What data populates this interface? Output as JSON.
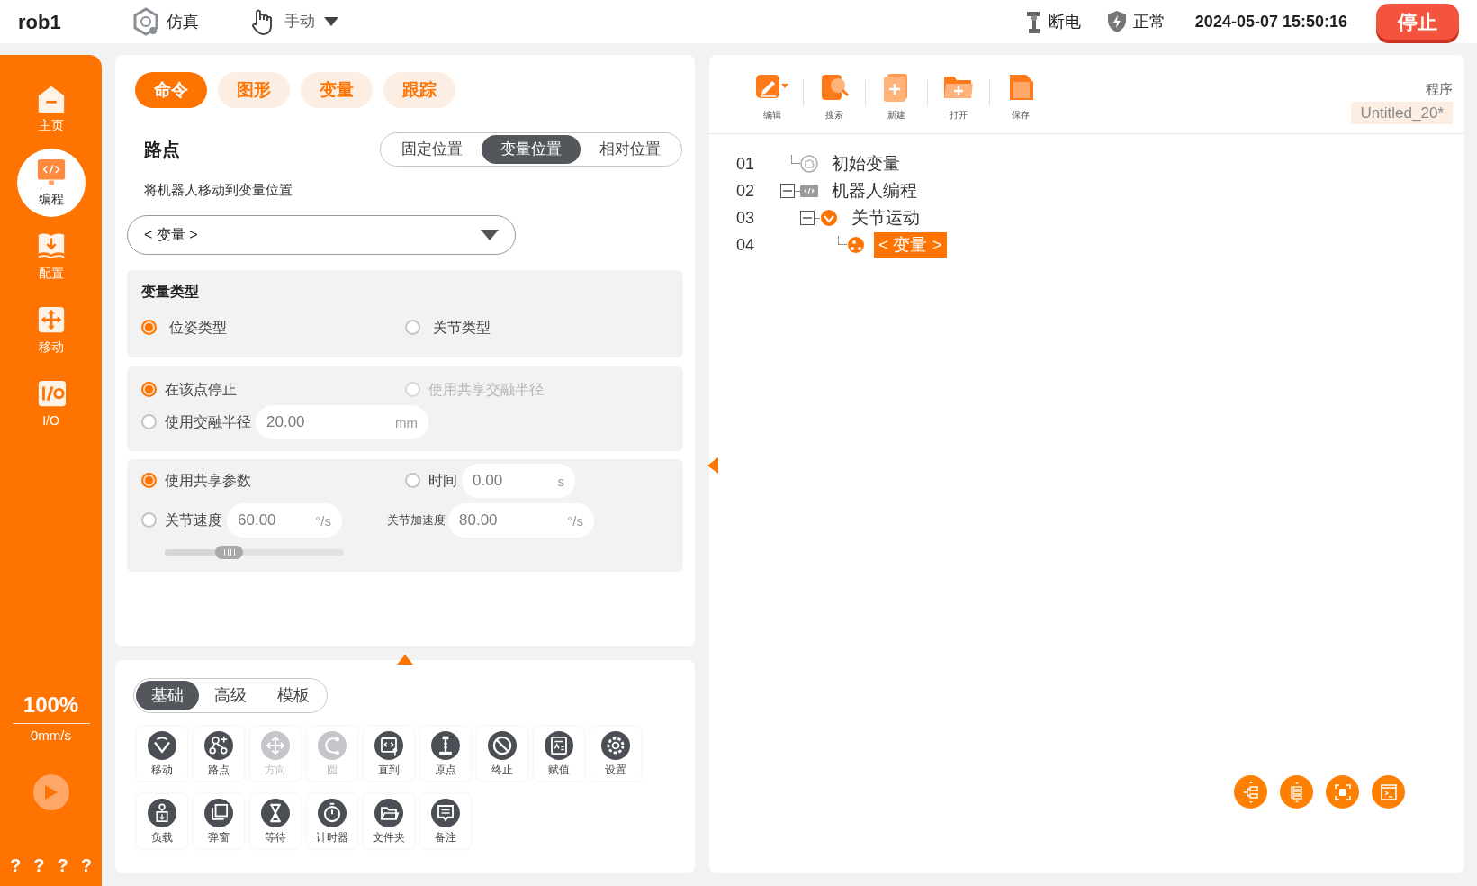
{
  "header": {
    "robot": "rob1",
    "mode": "仿真",
    "control": "手动",
    "power": "断电",
    "safety": "正常",
    "datetime": "2024-05-07 15:50:16",
    "stop": "停止"
  },
  "sidebar": {
    "items": [
      {
        "label": "主页",
        "selected": false
      },
      {
        "label": "编程",
        "selected": true
      },
      {
        "label": "配置",
        "selected": false
      },
      {
        "label": "移动",
        "selected": false
      },
      {
        "label": "I/O",
        "selected": false
      }
    ],
    "speed_percent": "100%",
    "speed": "0mm/s",
    "help": [
      "?",
      "?",
      "?",
      "?"
    ]
  },
  "command_panel": {
    "tabs": [
      {
        "label": "命令",
        "selected": true
      },
      {
        "label": "图形",
        "selected": false
      },
      {
        "label": "变量",
        "selected": false
      },
      {
        "label": "跟踪",
        "selected": false
      }
    ],
    "title": "路点",
    "position_modes": [
      {
        "label": "固定位置",
        "selected": false
      },
      {
        "label": "变量位置",
        "selected": true
      },
      {
        "label": "相对位置",
        "selected": false
      }
    ],
    "description": "将机器人移动到变量位置",
    "variable_select": {
      "value": "< 变量 >"
    },
    "variable_type": {
      "title": "变量类型",
      "options": [
        {
          "label": "位姿类型",
          "selected": true
        },
        {
          "label": "关节类型",
          "selected": false
        }
      ]
    },
    "blend": {
      "options": [
        {
          "label": "在该点停止",
          "selected": true,
          "disabled": false
        },
        {
          "label": "使用共享交融半径",
          "selected": false,
          "disabled": true
        },
        {
          "label": "使用交融半径",
          "selected": false,
          "disabled": false,
          "value": "20.00",
          "unit": "mm"
        }
      ]
    },
    "motion": {
      "shared": {
        "label": "使用共享参数",
        "selected": true
      },
      "time": {
        "label": "时间",
        "selected": false,
        "value": "0.00",
        "unit": "s"
      },
      "joint_speed": {
        "label": "关节速度",
        "selected": false,
        "value": "60.00",
        "unit": "°/s",
        "level": 0.36
      },
      "joint_accel": {
        "label": "关节加速度",
        "value": "80.00",
        "unit": "°/s"
      }
    }
  },
  "library": {
    "tabs": [
      {
        "label": "基础",
        "selected": true
      },
      {
        "label": "高级",
        "selected": false
      },
      {
        "label": "模板",
        "selected": false
      }
    ],
    "commands": [
      {
        "label": "移动",
        "disabled": false
      },
      {
        "label": "路点",
        "disabled": false
      },
      {
        "label": "方向",
        "disabled": true
      },
      {
        "label": "圆",
        "disabled": true
      },
      {
        "label": "直到",
        "disabled": false
      },
      {
        "label": "原点",
        "disabled": false
      },
      {
        "label": "终止",
        "disabled": false
      },
      {
        "label": "赋值",
        "disabled": false
      },
      {
        "label": "设置",
        "disabled": false
      },
      {
        "label": "负载",
        "disabled": false
      },
      {
        "label": "弹窗",
        "disabled": false
      },
      {
        "label": "等待",
        "disabled": false
      },
      {
        "label": "计时器",
        "disabled": false
      },
      {
        "label": "文件夹",
        "disabled": false
      },
      {
        "label": "备注",
        "disabled": false
      }
    ]
  },
  "program": {
    "toolbar": [
      {
        "label": "编辑"
      },
      {
        "label": "搜索"
      },
      {
        "label": "新建"
      },
      {
        "label": "打开"
      },
      {
        "label": "保存"
      }
    ],
    "program_label": "程序",
    "program_name": "Untitled_20*",
    "tree": [
      {
        "line": "01",
        "label": "初始变量",
        "selected": false
      },
      {
        "line": "02",
        "label": "机器人编程",
        "selected": false,
        "expanded": true,
        "children": [
          {
            "line": "03",
            "label": "关节运动",
            "selected": false,
            "expanded": true,
            "children": [
              {
                "line": "04",
                "label": "< 变量 >",
                "selected": true
              }
            ]
          }
        ]
      }
    ]
  }
}
